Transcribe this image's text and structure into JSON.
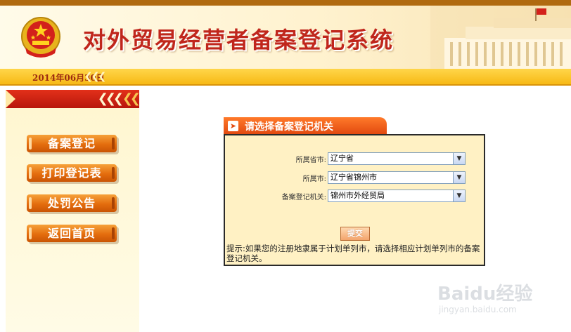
{
  "header": {
    "title": "对外贸易经营者备案登记系统",
    "date": "2014年06月30日"
  },
  "sidebar": {
    "items": [
      {
        "label": "备案登记"
      },
      {
        "label": "打印登记表"
      },
      {
        "label": "处罚公告"
      },
      {
        "label": "返回首页"
      }
    ]
  },
  "form": {
    "title": "请选择备案登记机关",
    "fields": [
      {
        "label": "所属省市:",
        "value": "辽宁省"
      },
      {
        "label": "所属市:",
        "value": "辽宁省锦州市"
      },
      {
        "label": "备案登记机关:",
        "value": "锦州市外经贸局"
      }
    ],
    "submit_label": "提交",
    "hint": "提示:如果您的注册地隶属于计划单列市，请选择相应计划单列市的备案登记机关。"
  },
  "watermark": {
    "text": "Baidu经验",
    "sub": "jingyan.baidu.com"
  },
  "colors": {
    "title_red": "#c0261c",
    "menu_orange": "#e46d0e",
    "panel_bg": "#fff1c4",
    "date_bar": "#f7b915"
  },
  "icons": [
    "national-emblem-icon",
    "building-icon",
    "arrow-right-icon",
    "chevron-down-icon"
  ]
}
